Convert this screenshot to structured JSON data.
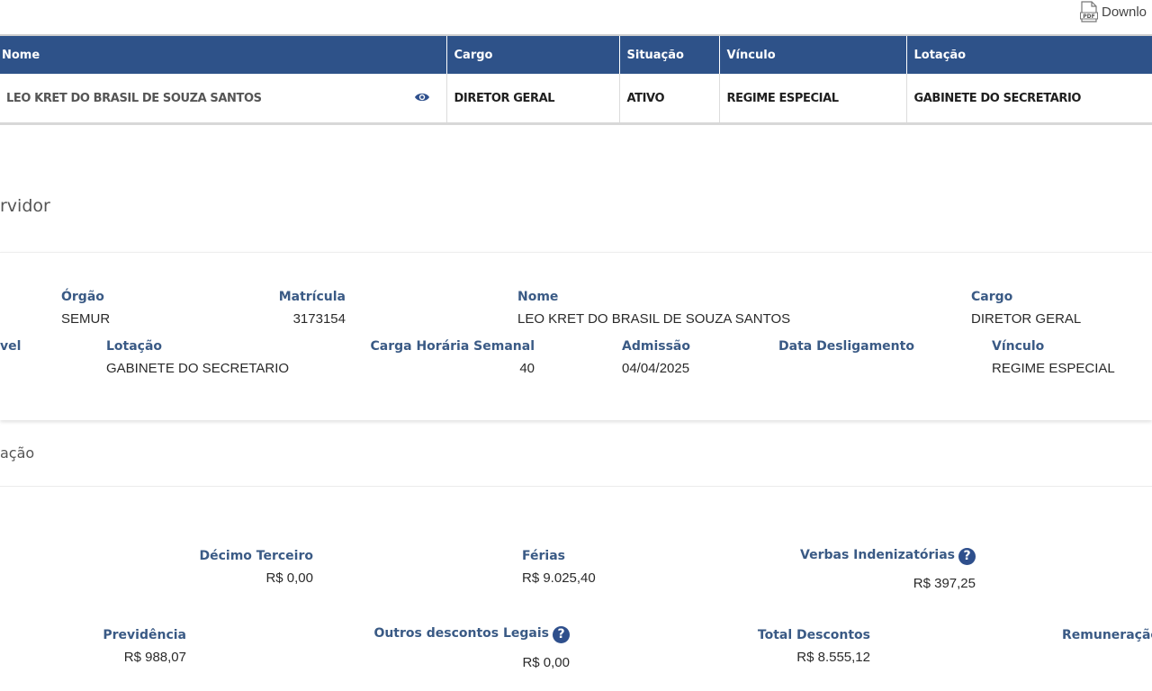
{
  "download": {
    "label": "Downlo",
    "icon": "pdf-file-icon"
  },
  "table": {
    "headers": {
      "nome": "Nome",
      "cargo": "Cargo",
      "situacao": "Situação",
      "vinculo": "Vínculo",
      "lotacao": "Lotação"
    },
    "row": {
      "nome": "LEO KRET DO BRASIL DE SOUZA SANTOS",
      "cargo": "DIRETOR GERAL",
      "situacao": "ATIVO",
      "vinculo": "REGIME ESPECIAL",
      "lotacao": "GABINETE DO SECRETARIO",
      "view_icon": "eye-icon"
    }
  },
  "servidor_section": {
    "title": "rvidor"
  },
  "info": {
    "orgao": {
      "label": "Órgão",
      "value": "SEMUR"
    },
    "matricula": {
      "label": "Matrícula",
      "value": "3173154"
    },
    "nome": {
      "label": "Nome",
      "value": "LEO KRET DO BRASIL DE SOUZA SANTOS"
    },
    "cargo": {
      "label": "Cargo",
      "value": "DIRETOR GERAL"
    },
    "nivel": {
      "label": "vel"
    },
    "lotacao": {
      "label": "Lotação",
      "value": "GABINETE DO SECRETARIO"
    },
    "carga": {
      "label": "Carga Horária Semanal",
      "value": "40"
    },
    "admissao": {
      "label": "Admissão",
      "value": "04/04/2025"
    },
    "desligamento": {
      "label": "Data Desligamento",
      "value": ""
    },
    "vinculo": {
      "label": "Vínculo",
      "value": "REGIME ESPECIAL"
    }
  },
  "remuneracao_section": {
    "title": "ação"
  },
  "remuneracao": {
    "decimo": {
      "label": "Décimo Terceiro",
      "value": "R$ 0,00"
    },
    "ferias": {
      "label": "Férias",
      "value": "R$ 9.025,40"
    },
    "verbas": {
      "label": "Verbas Indenizatórias",
      "value": "R$ 397,25",
      "help": "?"
    },
    "previdencia": {
      "label": "Previdência",
      "value": "R$ 988,07"
    },
    "outros": {
      "label": "Outros descontos Legais",
      "value": "R$ 0,00",
      "help": "?"
    },
    "total_descontos": {
      "label": "Total Descontos",
      "value": "R$ 8.555,12"
    },
    "remuneracao": {
      "label": "Remuneração"
    }
  },
  "colors": {
    "header_blue": "#2e5289",
    "label_blue": "#3a5a85",
    "help_blue": "#2e4f8c"
  }
}
